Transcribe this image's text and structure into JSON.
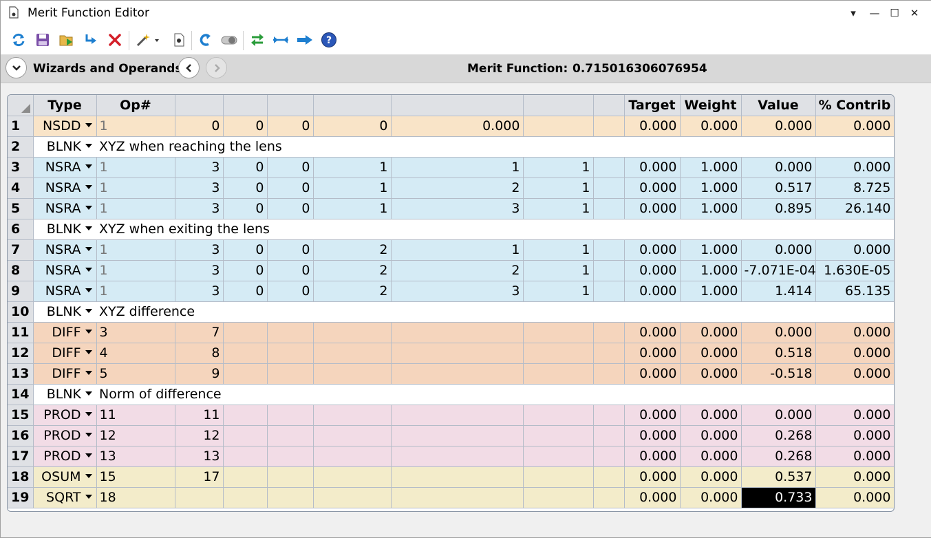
{
  "window": {
    "title": "Merit Function Editor"
  },
  "title_controls": {
    "dropdown": "▾",
    "minimize": "—",
    "maximize": "☐",
    "close": "✕"
  },
  "toolbar": [
    {
      "name": "refresh-icon"
    },
    {
      "name": "save-icon"
    },
    {
      "name": "load-icon"
    },
    {
      "name": "insert-icon"
    },
    {
      "name": "delete-icon"
    },
    {
      "name": "wizard-icon"
    },
    {
      "name": "file-icon"
    },
    {
      "name": "undo-icon"
    },
    {
      "name": "toggle-icon"
    },
    {
      "name": "swap-icon"
    },
    {
      "name": "collapse-icon"
    },
    {
      "name": "arrow-right-icon"
    },
    {
      "name": "help-icon"
    }
  ],
  "wizbar": {
    "label": "Wizards and Operands",
    "merit_label": "Merit Function:",
    "merit_value": "0.715016306076954"
  },
  "columns": [
    "Type",
    "Op#",
    "",
    "",
    "",
    "",
    "",
    "",
    "Target",
    "Weight",
    "Value",
    "% Contrib"
  ],
  "rows": [
    {
      "n": "1",
      "type": "NSDD",
      "kind": "nsdd",
      "c": [
        "1",
        "0",
        "0",
        "0",
        "0",
        "0.000",
        "",
        ""
      ],
      "target": "0.000",
      "weight": "0.000",
      "value": "0.000",
      "contrib": "0.000"
    },
    {
      "n": "2",
      "type": "BLNK",
      "kind": "blnk",
      "comment": "XYZ when reaching the lens"
    },
    {
      "n": "3",
      "type": "NSRA",
      "kind": "nsra",
      "c": [
        "1",
        "3",
        "0",
        "0",
        "1",
        "1",
        "1",
        ""
      ],
      "target": "0.000",
      "weight": "1.000",
      "value": "0.000",
      "contrib": "0.000"
    },
    {
      "n": "4",
      "type": "NSRA",
      "kind": "nsra",
      "c": [
        "1",
        "3",
        "0",
        "0",
        "1",
        "2",
        "1",
        ""
      ],
      "target": "0.000",
      "weight": "1.000",
      "value": "0.517",
      "contrib": "8.725"
    },
    {
      "n": "5",
      "type": "NSRA",
      "kind": "nsra",
      "c": [
        "1",
        "3",
        "0",
        "0",
        "1",
        "3",
        "1",
        ""
      ],
      "target": "0.000",
      "weight": "1.000",
      "value": "0.895",
      "contrib": "26.140"
    },
    {
      "n": "6",
      "type": "BLNK",
      "kind": "blnk",
      "comment": "XYZ when exiting the lens"
    },
    {
      "n": "7",
      "type": "NSRA",
      "kind": "nsra",
      "c": [
        "1",
        "3",
        "0",
        "0",
        "2",
        "1",
        "1",
        ""
      ],
      "target": "0.000",
      "weight": "1.000",
      "value": "0.000",
      "contrib": "0.000"
    },
    {
      "n": "8",
      "type": "NSRA",
      "kind": "nsra",
      "c": [
        "1",
        "3",
        "0",
        "0",
        "2",
        "2",
        "1",
        ""
      ],
      "target": "0.000",
      "weight": "1.000",
      "value": "-7.071E-04",
      "contrib": "1.630E-05"
    },
    {
      "n": "9",
      "type": "NSRA",
      "kind": "nsra",
      "c": [
        "1",
        "3",
        "0",
        "0",
        "2",
        "3",
        "1",
        ""
      ],
      "target": "0.000",
      "weight": "1.000",
      "value": "1.414",
      "contrib": "65.135"
    },
    {
      "n": "10",
      "type": "BLNK",
      "kind": "blnk",
      "comment": "XYZ difference"
    },
    {
      "n": "11",
      "type": "DIFF",
      "kind": "diff",
      "c": [
        "3",
        "7",
        "",
        "",
        "",
        "",
        "",
        ""
      ],
      "target": "0.000",
      "weight": "0.000",
      "value": "0.000",
      "contrib": "0.000"
    },
    {
      "n": "12",
      "type": "DIFF",
      "kind": "diff",
      "c": [
        "4",
        "8",
        "",
        "",
        "",
        "",
        "",
        ""
      ],
      "target": "0.000",
      "weight": "0.000",
      "value": "0.518",
      "contrib": "0.000"
    },
    {
      "n": "13",
      "type": "DIFF",
      "kind": "diff",
      "c": [
        "5",
        "9",
        "",
        "",
        "",
        "",
        "",
        ""
      ],
      "target": "0.000",
      "weight": "0.000",
      "value": "-0.518",
      "contrib": "0.000"
    },
    {
      "n": "14",
      "type": "BLNK",
      "kind": "blnk",
      "comment": "Norm of difference"
    },
    {
      "n": "15",
      "type": "PROD",
      "kind": "prod",
      "c": [
        "11",
        "11",
        "",
        "",
        "",
        "",
        "",
        ""
      ],
      "target": "0.000",
      "weight": "0.000",
      "value": "0.000",
      "contrib": "0.000"
    },
    {
      "n": "16",
      "type": "PROD",
      "kind": "prod",
      "c": [
        "12",
        "12",
        "",
        "",
        "",
        "",
        "",
        ""
      ],
      "target": "0.000",
      "weight": "0.000",
      "value": "0.268",
      "contrib": "0.000"
    },
    {
      "n": "17",
      "type": "PROD",
      "kind": "prod",
      "c": [
        "13",
        "13",
        "",
        "",
        "",
        "",
        "",
        ""
      ],
      "target": "0.000",
      "weight": "0.000",
      "value": "0.268",
      "contrib": "0.000"
    },
    {
      "n": "18",
      "type": "OSUM",
      "kind": "sum",
      "c": [
        "15",
        "17",
        "",
        "",
        "",
        "",
        "",
        ""
      ],
      "target": "0.000",
      "weight": "0.000",
      "value": "0.537",
      "contrib": "0.000"
    },
    {
      "n": "19",
      "type": "SQRT",
      "kind": "sum",
      "c": [
        "18",
        "",
        "",
        "",
        "",
        "",
        "",
        ""
      ],
      "target": "0.000",
      "weight": "0.000",
      "value": "0.733",
      "contrib": "0.000",
      "selected": true
    }
  ]
}
